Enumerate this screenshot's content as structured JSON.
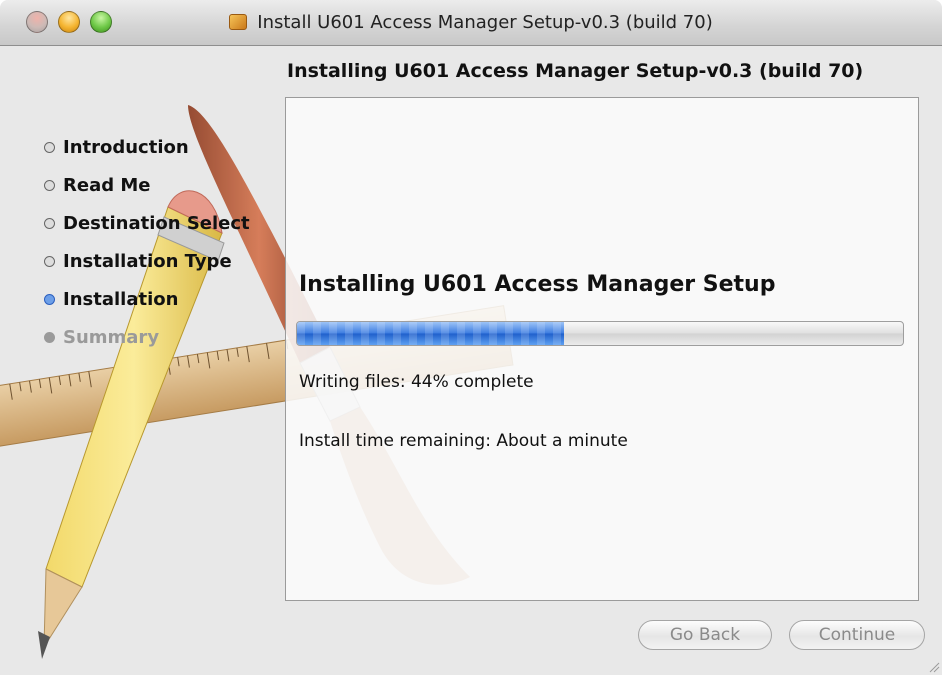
{
  "window": {
    "title": "Install U601 Access Manager Setup-v0.3 (build 70)",
    "title_icon": "package-icon"
  },
  "header": {
    "title": "Installing U601 Access Manager Setup-v0.3 (build 70)"
  },
  "sidebar": {
    "steps": [
      {
        "label": "Introduction",
        "state": "done"
      },
      {
        "label": "Read Me",
        "state": "done"
      },
      {
        "label": "Destination Select",
        "state": "done"
      },
      {
        "label": "Installation Type",
        "state": "done"
      },
      {
        "label": "Installation",
        "state": "current"
      },
      {
        "label": "Summary",
        "state": "pending"
      }
    ]
  },
  "main": {
    "heading": "Installing U601 Access Manager Setup",
    "progress_percent": 44,
    "status": "Writing files: 44% complete",
    "time_remaining": "Install time remaining: About a minute"
  },
  "buttons": {
    "back": "Go Back",
    "continue": "Continue"
  },
  "colors": {
    "progress_fill": "#3b7be0",
    "current_step": "#2b5fbf",
    "disabled_text": "#8a8a8a"
  }
}
